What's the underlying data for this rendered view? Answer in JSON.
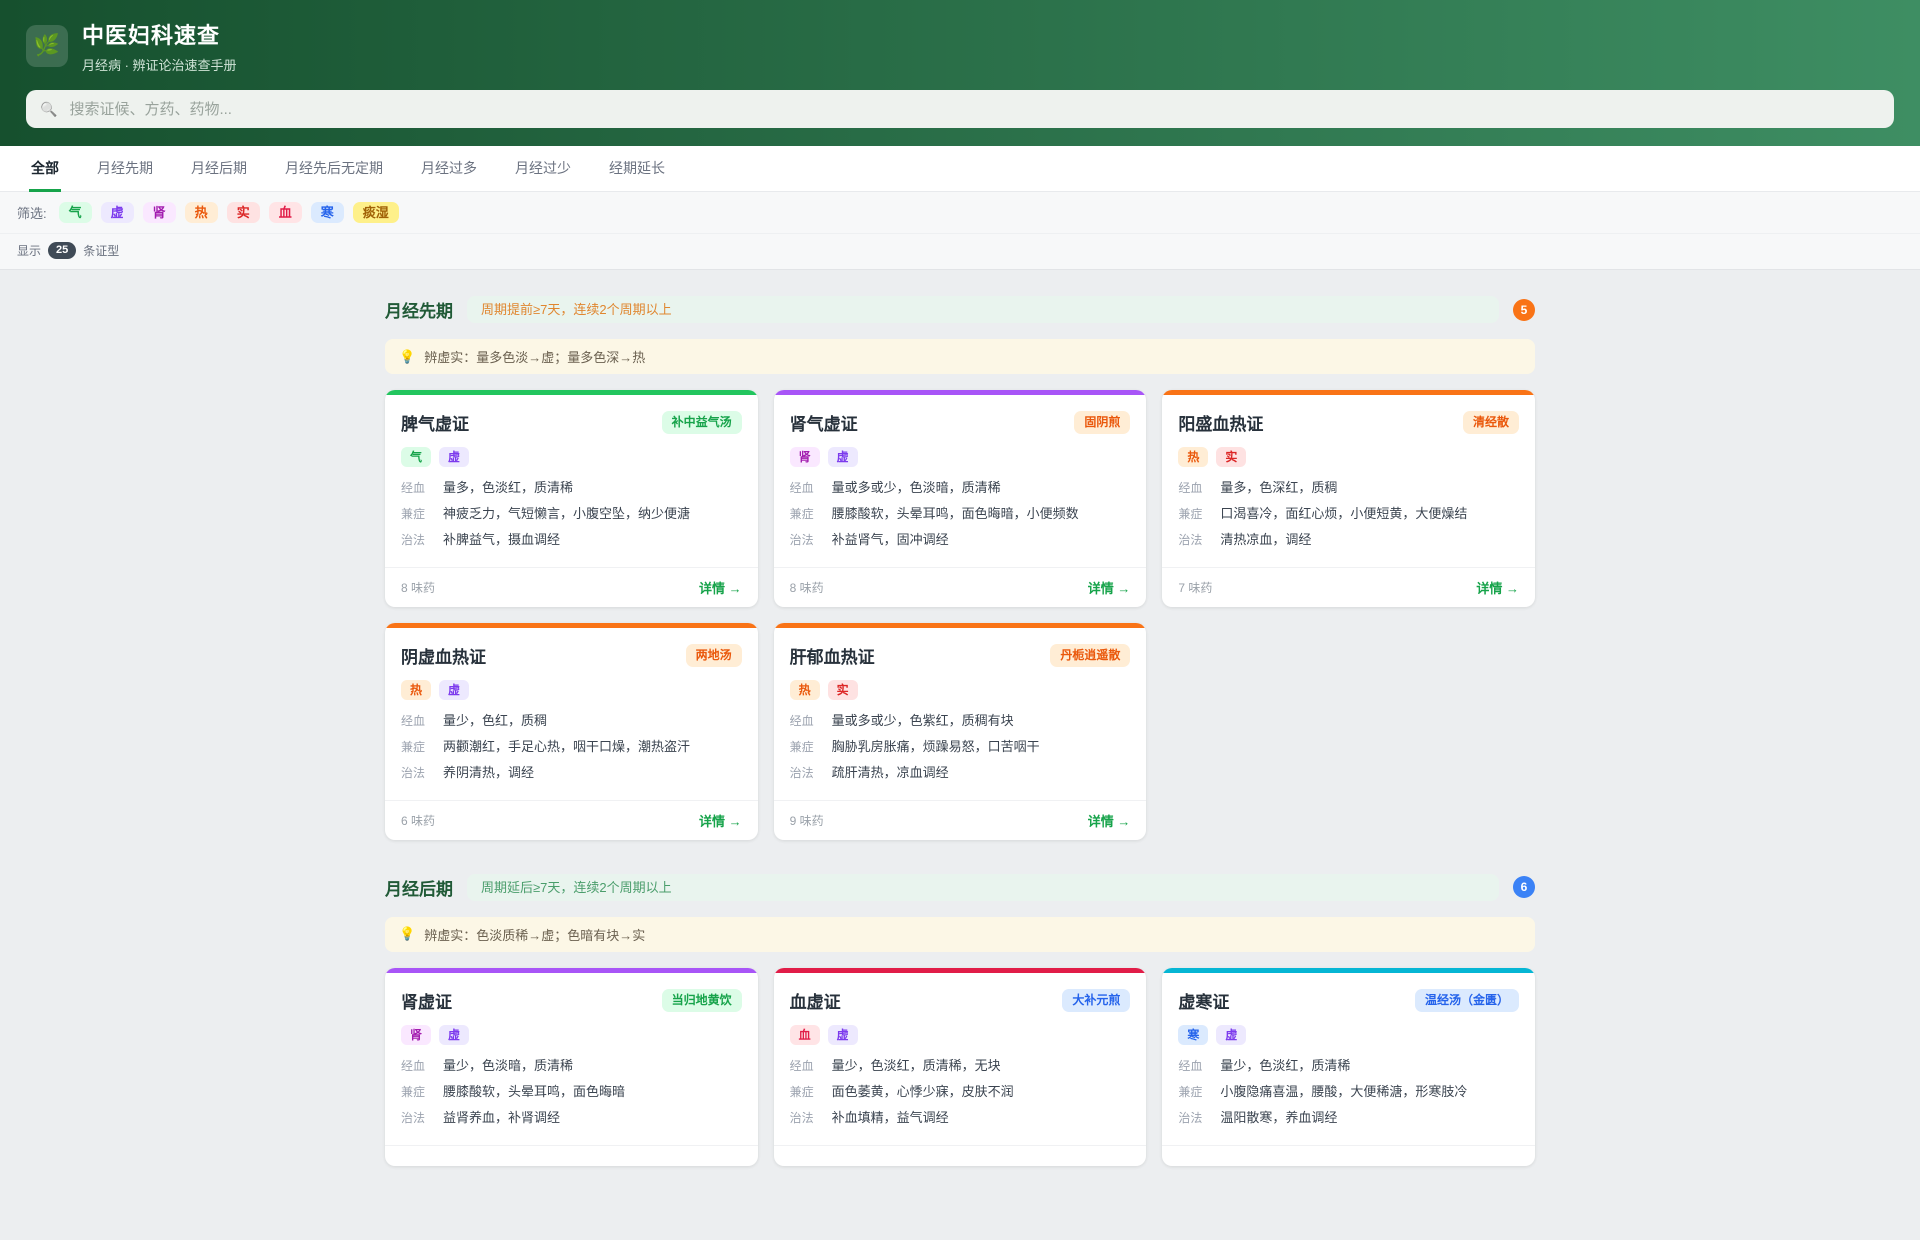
{
  "theme": {
    "brand": "#16a34a",
    "header_gradient_left": "#16502e",
    "header_gradient_right": "#3e8e63"
  },
  "header": {
    "logo_icon": "🌿",
    "title": "中医妇科速查",
    "subtitle": "月经病 · 辨证论治速查手册",
    "search": {
      "icon": "🔍",
      "placeholder": "搜索证候、方药、药物..."
    }
  },
  "tabs": [
    {
      "label": "全部",
      "active": true
    },
    {
      "label": "月经先期",
      "active": false
    },
    {
      "label": "月经后期",
      "active": false
    },
    {
      "label": "月经先后无定期",
      "active": false
    },
    {
      "label": "月经过多",
      "active": false
    },
    {
      "label": "月经过少",
      "active": false
    },
    {
      "label": "经期延长",
      "active": false
    }
  ],
  "filter_bar": {
    "label": "筛选:",
    "tags": [
      "气",
      "虚",
      "肾",
      "热",
      "实",
      "血",
      "寒",
      "痰湿"
    ]
  },
  "tag_colors": {
    "气": {
      "bg": "#dcfce7",
      "fg": "#16a34a"
    },
    "虚": {
      "bg": "#ede9fe",
      "fg": "#7c3aed"
    },
    "肾": {
      "bg": "#fae8ff",
      "fg": "#a21caf"
    },
    "热": {
      "bg": "#ffedd5",
      "fg": "#ea580c"
    },
    "实": {
      "bg": "#fee2e2",
      "fg": "#dc2626"
    },
    "血": {
      "bg": "#ffe4e6",
      "fg": "#e11d48"
    },
    "寒": {
      "bg": "#dbeafe",
      "fg": "#2563eb"
    },
    "痰湿": {
      "bg": "#fef08a",
      "fg": "#a16207"
    }
  },
  "formula_styles": {
    "green": {
      "bg": "#dcfce7",
      "fg": "#16a34a"
    },
    "orange": {
      "bg": "#ffedd5",
      "fg": "#ea580c"
    },
    "blue": {
      "bg": "#dbeafe",
      "fg": "#2563eb"
    }
  },
  "result_bar": {
    "prefix": "显示",
    "count": "25",
    "suffix": "条证型"
  },
  "sections": [
    {
      "title": "月经先期",
      "note": "周期提前≥7天，连续2个周期以上",
      "note_color": "#e0862f",
      "note_bg": "#e9f4ee",
      "badge": "5",
      "badge_bg": "#f97316",
      "tip_icon": "💡",
      "tip": "辨虚实：量多色淡→虚；量多色深→热",
      "cards": [
        {
          "name": "脾气虚证",
          "formula": "补中益气汤",
          "formula_style": "green",
          "accent": "#22c55e",
          "tags": [
            "气",
            "虚"
          ],
          "rows": [
            {
              "label": "经血",
              "text": "量多，色淡红，质清稀"
            },
            {
              "label": "兼症",
              "text": "神疲乏力，气短懒言，小腹空坠，纳少便溏"
            },
            {
              "label": "治法",
              "text": "补脾益气，摄血调经"
            }
          ],
          "herbs": "8 味药",
          "detail": "详情 →"
        },
        {
          "name": "肾气虚证",
          "formula": "固阴煎",
          "formula_style": "orange",
          "accent": "#a855f7",
          "tags": [
            "肾",
            "虚"
          ],
          "rows": [
            {
              "label": "经血",
              "text": "量或多或少，色淡暗，质清稀"
            },
            {
              "label": "兼症",
              "text": "腰膝酸软，头晕耳鸣，面色晦暗，小便频数"
            },
            {
              "label": "治法",
              "text": "补益肾气，固冲调经"
            }
          ],
          "herbs": "8 味药",
          "detail": "详情 →"
        },
        {
          "name": "阳盛血热证",
          "formula": "清经散",
          "formula_style": "orange",
          "accent": "#f97316",
          "tags": [
            "热",
            "实"
          ],
          "rows": [
            {
              "label": "经血",
              "text": "量多，色深红，质稠"
            },
            {
              "label": "兼症",
              "text": "口渴喜冷，面红心烦，小便短黄，大便燥结"
            },
            {
              "label": "治法",
              "text": "清热凉血，调经"
            }
          ],
          "herbs": "7 味药",
          "detail": "详情 →"
        },
        {
          "name": "阴虚血热证",
          "formula": "两地汤",
          "formula_style": "orange",
          "accent": "#f97316",
          "tags": [
            "热",
            "虚"
          ],
          "rows": [
            {
              "label": "经血",
              "text": "量少，色红，质稠"
            },
            {
              "label": "兼症",
              "text": "两颧潮红，手足心热，咽干口燥，潮热盗汗"
            },
            {
              "label": "治法",
              "text": "养阴清热，调经"
            }
          ],
          "herbs": "6 味药",
          "detail": "详情 →"
        },
        {
          "name": "肝郁血热证",
          "formula": "丹栀逍遥散",
          "formula_style": "orange",
          "accent": "#f97316",
          "tags": [
            "热",
            "实"
          ],
          "rows": [
            {
              "label": "经血",
              "text": "量或多或少，色紫红，质稠有块"
            },
            {
              "label": "兼症",
              "text": "胸胁乳房胀痛，烦躁易怒，口苦咽干"
            },
            {
              "label": "治法",
              "text": "疏肝清热，凉血调经"
            }
          ],
          "herbs": "9 味药",
          "detail": "详情 →"
        }
      ]
    },
    {
      "title": "月经后期",
      "note": "周期延后≥7天，连续2个周期以上",
      "note_color": "#4a9d6b",
      "note_bg": "#e9f4ee",
      "badge": "6",
      "badge_bg": "#3b82f6",
      "tip_icon": "💡",
      "tip": "辨虚实：色淡质稀→虚；色暗有块→实",
      "cards": [
        {
          "name": "肾虚证",
          "formula": "当归地黄饮",
          "formula_style": "green",
          "accent": "#a855f7",
          "tags": [
            "肾",
            "虚"
          ],
          "rows": [
            {
              "label": "经血",
              "text": "量少，色淡暗，质清稀"
            },
            {
              "label": "兼症",
              "text": "腰膝酸软，头晕耳鸣，面色晦暗"
            },
            {
              "label": "治法",
              "text": "益肾养血，补肾调经"
            }
          ],
          "herbs": "",
          "detail": ""
        },
        {
          "name": "血虚证",
          "formula": "大补元煎",
          "formula_style": "blue",
          "accent": "#e11d48",
          "tags": [
            "血",
            "虚"
          ],
          "rows": [
            {
              "label": "经血",
              "text": "量少，色淡红，质清稀，无块"
            },
            {
              "label": "兼症",
              "text": "面色萎黄，心悸少寐，皮肤不润"
            },
            {
              "label": "治法",
              "text": "补血填精，益气调经"
            }
          ],
          "herbs": "",
          "detail": ""
        },
        {
          "name": "虚寒证",
          "formula": "温经汤（金匮）",
          "formula_style": "blue",
          "accent": "#06b6d4",
          "tags": [
            "寒",
            "虚"
          ],
          "rows": [
            {
              "label": "经血",
              "text": "量少，色淡红，质清稀"
            },
            {
              "label": "兼症",
              "text": "小腹隐痛喜温，腰酸，大便稀溏，形寒肢冷"
            },
            {
              "label": "治法",
              "text": "温阳散寒，养血调经"
            }
          ],
          "herbs": "",
          "detail": ""
        }
      ]
    }
  ]
}
